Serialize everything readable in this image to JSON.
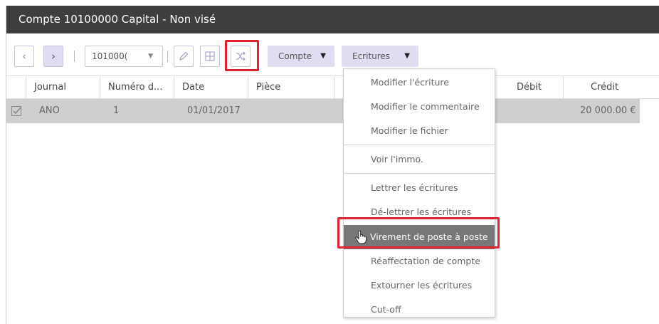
{
  "window": {
    "title": "Compte 10100000 Capital - Non visé"
  },
  "toolbar": {
    "prev_glyph": "‹",
    "next_glyph": "›",
    "account_select_value": "101000(",
    "account_select_arrow": "▼",
    "compte_label": "Compte",
    "ecritures_label": "Ecritures",
    "caret": "▼",
    "icons": [
      "pencil-icon",
      "split-icon",
      "shuffle-icon"
    ]
  },
  "table": {
    "columns": [
      "Journal",
      "Numéro d...",
      "Date",
      "Pièce",
      "Débit",
      "Crédit"
    ],
    "rows": [
      {
        "journal": "ANO",
        "numero": "1",
        "date": "01/01/2017",
        "piece": "",
        "debit": "",
        "credit": "20 000.00 €"
      }
    ]
  },
  "menu": {
    "items": [
      "Modifier l'écriture",
      "Modifier le commentaire",
      "Modifier le fichier",
      "Voir l'immo.",
      "Lettrer les écritures",
      "Dé-lettrer les écritures",
      "Virement de poste à poste",
      "Réaffectation de compte",
      "Extourner les écritures",
      "Cut-off"
    ],
    "active_index": 6
  },
  "colors": {
    "titlebar": "#3e3e3e",
    "highlight_box": "#e0222e",
    "dropdown_bg": "#e2dcf2",
    "selected_row": "#cfcfcf",
    "active_menu_item": "#777777"
  }
}
